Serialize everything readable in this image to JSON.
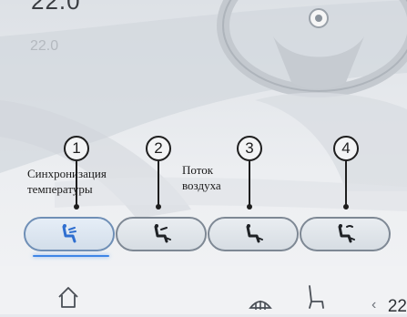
{
  "header": {
    "temperature_top": "22.0",
    "temperature_value": "22.0"
  },
  "callouts": [
    "1",
    "2",
    "3",
    "4"
  ],
  "annotations": {
    "sync": [
      "Синхронизация",
      "температуры"
    ],
    "airflow": [
      "Поток",
      "воздуха"
    ]
  },
  "airflow_modes": [
    {
      "icon": "seat-airflow-face-icon",
      "active": true
    },
    {
      "icon": "seat-airflow-face-feet-icon",
      "active": false
    },
    {
      "icon": "seat-airflow-feet-icon",
      "active": false
    },
    {
      "icon": "seat-airflow-defrost-feet-icon",
      "active": false
    }
  ],
  "dock": {
    "temperature": "22",
    "chevron": "‹"
  },
  "colors": {
    "accent": "#3f86e6",
    "background": "#e6e9ed"
  }
}
